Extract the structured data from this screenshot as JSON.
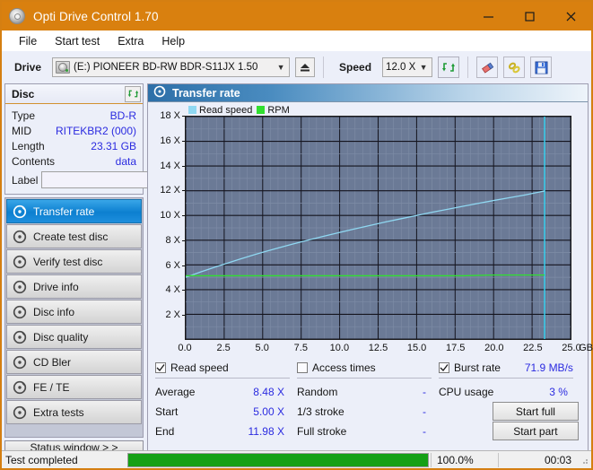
{
  "window": {
    "title": "Opti Drive Control 1.70",
    "icon": "disc-icon",
    "minimize": "─",
    "maximize": "□",
    "close": "✕"
  },
  "menu": {
    "items": [
      "File",
      "Start test",
      "Extra",
      "Help"
    ]
  },
  "toolbar": {
    "drive_label": "Drive",
    "drive_value": "(E:)   PIONEER BD-RW  BDR-S11JX 1.50",
    "eject_icon": "eject-icon",
    "speed_label": "Speed",
    "speed_value": "12.0 X",
    "refresh_icon": "refresh-icon",
    "eraser_icon": "eraser-icon",
    "chain_icon": "chain-icon",
    "save_icon": "save-icon"
  },
  "disc_panel": {
    "title": "Disc",
    "refresh_icon": "refresh-icon",
    "rows": [
      {
        "key": "Type",
        "value": "BD-R"
      },
      {
        "key": "MID",
        "value": "RITEKBR2 (000)"
      },
      {
        "key": "Length",
        "value": "23.31 GB"
      },
      {
        "key": "Contents",
        "value": "data"
      }
    ],
    "label_key": "Label",
    "label_value": "",
    "label_button_icon": "disc-icon"
  },
  "sidebar": {
    "items": [
      {
        "label": "Transfer rate",
        "icon": "disc-test-icon",
        "selected": true
      },
      {
        "label": "Create test disc",
        "icon": "disc-test-icon",
        "selected": false
      },
      {
        "label": "Verify test disc",
        "icon": "disc-test-icon",
        "selected": false
      },
      {
        "label": "Drive info",
        "icon": "disc-test-icon",
        "selected": false
      },
      {
        "label": "Disc info",
        "icon": "disc-test-icon",
        "selected": false
      },
      {
        "label": "Disc quality",
        "icon": "disc-test-icon",
        "selected": false
      },
      {
        "label": "CD Bler",
        "icon": "disc-test-icon",
        "selected": false
      },
      {
        "label": "FE / TE",
        "icon": "disc-test-icon",
        "selected": false
      },
      {
        "label": "Extra tests",
        "icon": "disc-test-icon",
        "selected": false
      }
    ],
    "status_window": "Status window > >"
  },
  "chart_panel": {
    "title": "Transfer rate",
    "title_icon": "disc-test-icon"
  },
  "chart_data": {
    "type": "line",
    "title": "Transfer rate",
    "xlabel": "GB",
    "ylabel": "X",
    "xlim": [
      0.0,
      25.0
    ],
    "ylim": [
      0,
      18
    ],
    "x_ticks": [
      "0.0",
      "2.5",
      "5.0",
      "7.5",
      "10.0",
      "12.5",
      "15.0",
      "17.5",
      "20.0",
      "22.5",
      "25.0"
    ],
    "x_tick_values": [
      0.0,
      2.5,
      5.0,
      7.5,
      10.0,
      12.5,
      15.0,
      17.5,
      20.0,
      22.5,
      25.0
    ],
    "x_unit": "GB",
    "y_ticks": [
      "2 X",
      "4 X",
      "6 X",
      "8 X",
      "10 X",
      "12 X",
      "14 X",
      "16 X",
      "18 X"
    ],
    "y_tick_values": [
      2,
      4,
      6,
      8,
      10,
      12,
      14,
      16,
      18
    ],
    "grid": true,
    "legend_position": "top-left",
    "plot_bg": "#6b7a96",
    "legend": [
      {
        "name": "Read speed",
        "color": "#8fd8f2"
      },
      {
        "name": "RPM",
        "color": "#30e030"
      }
    ],
    "marker_line": {
      "x": 23.31,
      "color": "#35d0ef"
    },
    "series": [
      {
        "name": "Read speed",
        "color": "#8fd8f2",
        "x": [
          0.0,
          0.5,
          1.0,
          1.5,
          2.0,
          2.5,
          3.0,
          3.5,
          4.0,
          4.5,
          5.0,
          6.0,
          7.0,
          8.0,
          9.0,
          10.0,
          11.0,
          12.0,
          13.0,
          14.0,
          15.0,
          16.0,
          17.0,
          18.0,
          19.0,
          20.0,
          21.0,
          22.0,
          23.0,
          23.31
        ],
        "y": [
          5.0,
          5.22,
          5.44,
          5.65,
          5.86,
          6.06,
          6.26,
          6.46,
          6.65,
          6.84,
          7.02,
          7.37,
          7.7,
          8.02,
          8.33,
          8.63,
          8.92,
          9.2,
          9.48,
          9.74,
          10.0,
          10.26,
          10.5,
          10.74,
          10.98,
          11.21,
          11.43,
          11.65,
          11.9,
          11.98
        ]
      },
      {
        "name": "RPM",
        "color": "#30e030",
        "x": [
          0.0,
          2.0,
          4.0,
          6.0,
          8.0,
          10.0,
          12.0,
          14.0,
          16.0,
          18.0,
          20.0,
          22.0,
          23.31
        ],
        "y": [
          5.12,
          5.12,
          5.12,
          5.12,
          5.12,
          5.12,
          5.12,
          5.12,
          5.12,
          5.12,
          5.18,
          5.18,
          5.18
        ]
      }
    ]
  },
  "stats": {
    "read_speed": {
      "label": "Read speed",
      "checked": true,
      "value": ""
    },
    "access_times": {
      "label": "Access times",
      "checked": false,
      "value": ""
    },
    "burst_rate": {
      "label": "Burst rate",
      "checked": true,
      "value": "71.9 MB/s"
    },
    "rows": [
      {
        "c1k": "Average",
        "c1v": "8.48 X",
        "c2k": "Random",
        "c2v": "-",
        "c3k": "CPU usage",
        "c3v": "3 %"
      },
      {
        "c1k": "Start",
        "c1v": "5.00 X",
        "c2k": "1/3 stroke",
        "c2v": "-",
        "c3k": "",
        "c3v": ""
      },
      {
        "c1k": "End",
        "c1v": "11.98 X",
        "c2k": "Full stroke",
        "c2v": "-",
        "c3k": "",
        "c3v": ""
      }
    ],
    "start_full": "Start full",
    "start_part": "Start part"
  },
  "statusbar": {
    "text": "Test completed",
    "progress_percent": 100.0,
    "progress_label": "100.0%",
    "elapsed": "00:03"
  },
  "colors": {
    "titlebar": "#d9800f",
    "accent_blue": "#2b2be0",
    "progress_green": "#15a015",
    "read_speed": "#8fd8f2",
    "rpm": "#30e030"
  }
}
